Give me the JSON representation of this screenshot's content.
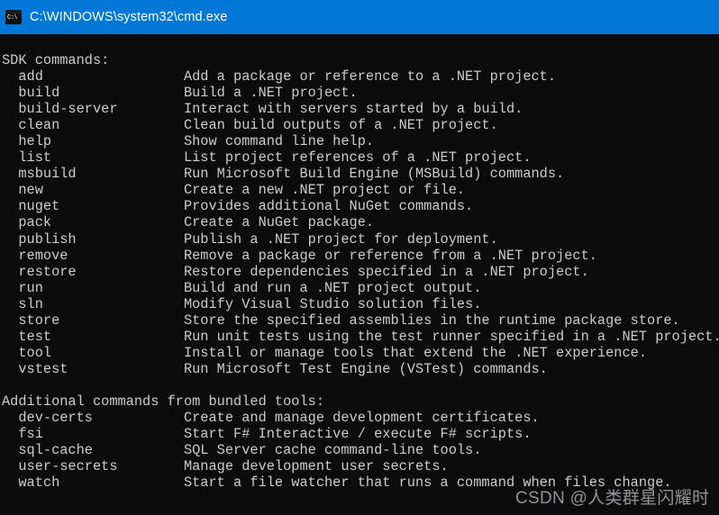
{
  "window": {
    "title": "C:\\WINDOWS\\system32\\cmd.exe",
    "icon": "console-icon",
    "icon_glyph": "C:\\",
    "titlebar_color": "#0078d7",
    "background_color": "#0c0c0c",
    "text_color": "#cccccc"
  },
  "terminal": {
    "sections": [
      {
        "heading": "SDK commands:",
        "commands": [
          {
            "name": "add",
            "description": "Add a package or reference to a .NET project."
          },
          {
            "name": "build",
            "description": "Build a .NET project."
          },
          {
            "name": "build-server",
            "description": "Interact with servers started by a build."
          },
          {
            "name": "clean",
            "description": "Clean build outputs of a .NET project."
          },
          {
            "name": "help",
            "description": "Show command line help."
          },
          {
            "name": "list",
            "description": "List project references of a .NET project."
          },
          {
            "name": "msbuild",
            "description": "Run Microsoft Build Engine (MSBuild) commands."
          },
          {
            "name": "new",
            "description": "Create a new .NET project or file."
          },
          {
            "name": "nuget",
            "description": "Provides additional NuGet commands."
          },
          {
            "name": "pack",
            "description": "Create a NuGet package."
          },
          {
            "name": "publish",
            "description": "Publish a .NET project for deployment."
          },
          {
            "name": "remove",
            "description": "Remove a package or reference from a .NET project."
          },
          {
            "name": "restore",
            "description": "Restore dependencies specified in a .NET project."
          },
          {
            "name": "run",
            "description": "Build and run a .NET project output."
          },
          {
            "name": "sln",
            "description": "Modify Visual Studio solution files."
          },
          {
            "name": "store",
            "description": "Store the specified assemblies in the runtime package store."
          },
          {
            "name": "test",
            "description": "Run unit tests using the test runner specified in a .NET project."
          },
          {
            "name": "tool",
            "description": "Install or manage tools that extend the .NET experience."
          },
          {
            "name": "vstest",
            "description": "Run Microsoft Test Engine (VSTest) commands."
          }
        ]
      },
      {
        "heading": "Additional commands from bundled tools:",
        "commands": [
          {
            "name": "dev-certs",
            "description": "Create and manage development certificates."
          },
          {
            "name": "fsi",
            "description": "Start F# Interactive / execute F# scripts."
          },
          {
            "name": "sql-cache",
            "description": "SQL Server cache command-line tools."
          },
          {
            "name": "user-secrets",
            "description": "Manage development user secrets."
          },
          {
            "name": "watch",
            "description": "Start a file watcher that runs a command when files change."
          }
        ]
      }
    ],
    "output_text": "SDK commands:\n  add                 Add a package or reference to a .NET project.\n  build               Build a .NET project.\n  build-server        Interact with servers started by a build.\n  clean               Clean build outputs of a .NET project.\n  help                Show command line help.\n  list                List project references of a .NET project.\n  msbuild             Run Microsoft Build Engine (MSBuild) commands.\n  new                 Create a new .NET project or file.\n  nuget               Provides additional NuGet commands.\n  pack                Create a NuGet package.\n  publish             Publish a .NET project for deployment.\n  remove              Remove a package or reference from a .NET project.\n  restore             Restore dependencies specified in a .NET project.\n  run                 Build and run a .NET project output.\n  sln                 Modify Visual Studio solution files.\n  store               Store the specified assemblies in the runtime package store.\n  test                Run unit tests using the test runner specified in a .NET project.\n  tool                Install or manage tools that extend the .NET experience.\n  vstest              Run Microsoft Test Engine (VSTest) commands.\n\nAdditional commands from bundled tools:\n  dev-certs           Create and manage development certificates.\n  fsi                 Start F# Interactive / execute F# scripts.\n  sql-cache           SQL Server cache command-line tools.\n  user-secrets        Manage development user secrets.\n  watch               Start a file watcher that runs a command when files change."
  },
  "watermark": {
    "text": "CSDN @人类群星闪耀时"
  }
}
